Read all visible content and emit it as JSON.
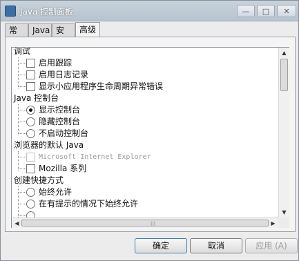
{
  "window": {
    "title": "Java 控制面板",
    "minimize_glyph": "—",
    "maximize_glyph": "□",
    "close_glyph": "✕"
  },
  "tabs": [
    {
      "label": "常规",
      "active": false
    },
    {
      "label": "Java",
      "active": false
    },
    {
      "label": "安全",
      "active": false
    },
    {
      "label": "高级",
      "active": true
    }
  ],
  "tree": {
    "debug": {
      "label": "调试",
      "items": [
        "启用跟踪",
        "启用日志记录",
        "显示小应用程序生命周期异常错误"
      ]
    },
    "console": {
      "label": "Java 控制台",
      "items": [
        "显示控制台",
        "隐藏控制台",
        "不启动控制台"
      ],
      "selected": "显示控制台"
    },
    "browser": {
      "label": "浏览器的默认 Java",
      "items": [
        "Microsoft Internet Explorer",
        "Mozilla 系列"
      ]
    },
    "shortcut": {
      "label": "创建快捷方式",
      "items": [
        "始终允许",
        "在有提示的情况下始终允许"
      ]
    }
  },
  "scroll": {
    "up_arrow": "▲",
    "down_arrow": "▼",
    "left_arrow": "◀",
    "right_arrow": "▶",
    "grip": "|||"
  },
  "buttons": {
    "ok": "确定",
    "cancel": "取消",
    "apply": "应用 (A)"
  }
}
